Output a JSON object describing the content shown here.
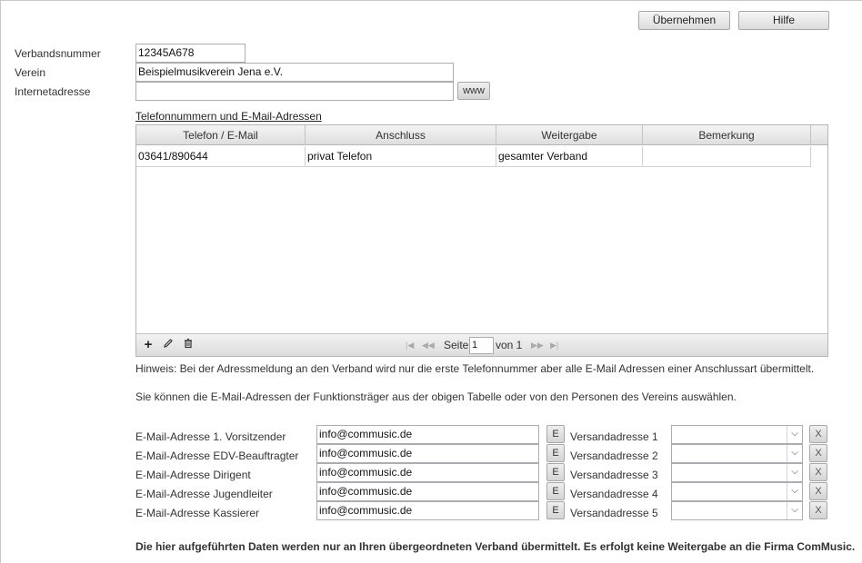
{
  "toolbar": {
    "apply_label": "Übernehmen",
    "help_label": "Hilfe"
  },
  "form": {
    "verbandsnummer_label": "Verbandsnummer",
    "verbandsnummer_value": "12345A678",
    "verein_label": "Verein",
    "verein_value": "Beispielmusikverein Jena e.V.",
    "internet_label": "Internetadresse",
    "internet_value": "",
    "www_button": "www"
  },
  "phones": {
    "section_title": "Telefonnummern und E-Mail-Adressen",
    "columns": [
      "Telefon / E-Mail",
      "Anschluss",
      "Weitergabe",
      "Bemerkung"
    ],
    "rows": [
      [
        "03641/890644",
        "privat Telefon",
        "gesamter Verband",
        ""
      ]
    ],
    "toolbar": {
      "add_icon": "+",
      "edit_icon": "✎",
      "delete_icon": "🗑"
    },
    "pager": {
      "page_label": "Seite",
      "page_value": "1",
      "of_label": "von 1"
    }
  },
  "notes": {
    "hint": "Hinweis: Bei der Adressmeldung an den Verband wird nur die erste Telefonnummer aber alle E-Mail Adressen einer Anschlussart übermittelt.",
    "select_hint": "Sie können die E-Mail-Adressen der Funktionsträger aus der obigen Tabelle oder von den Personen des Vereins auswählen.",
    "footer": "Die hier aufgeführten Daten werden nur an Ihren übergeordneten Verband übermittelt. Es erfolgt keine Weitergabe an die Firma ComMusic."
  },
  "emails": [
    {
      "label": "E-Mail-Adresse 1. Vorsitzender",
      "value": "info@commusic.de",
      "e_button": "E",
      "versand_label": "Versandadresse 1",
      "versand_value": "",
      "x_button": "X"
    },
    {
      "label": "E-Mail-Adresse EDV-Beauftragter",
      "value": "info@commusic.de",
      "e_button": "E",
      "versand_label": "Versandadresse 2",
      "versand_value": "",
      "x_button": "X"
    },
    {
      "label": "E-Mail-Adresse Dirigent",
      "value": "info@commusic.de",
      "e_button": "E",
      "versand_label": "Versandadresse 3",
      "versand_value": "",
      "x_button": "X"
    },
    {
      "label": "E-Mail-Adresse Jugendleiter",
      "value": "info@commusic.de",
      "e_button": "E",
      "versand_label": "Versandadresse 4",
      "versand_value": "",
      "x_button": "X"
    },
    {
      "label": "E-Mail-Adresse Kassierer",
      "value": "info@commusic.de",
      "e_button": "E",
      "versand_label": "Versandadresse 5",
      "versand_value": "",
      "x_button": "X"
    }
  ]
}
